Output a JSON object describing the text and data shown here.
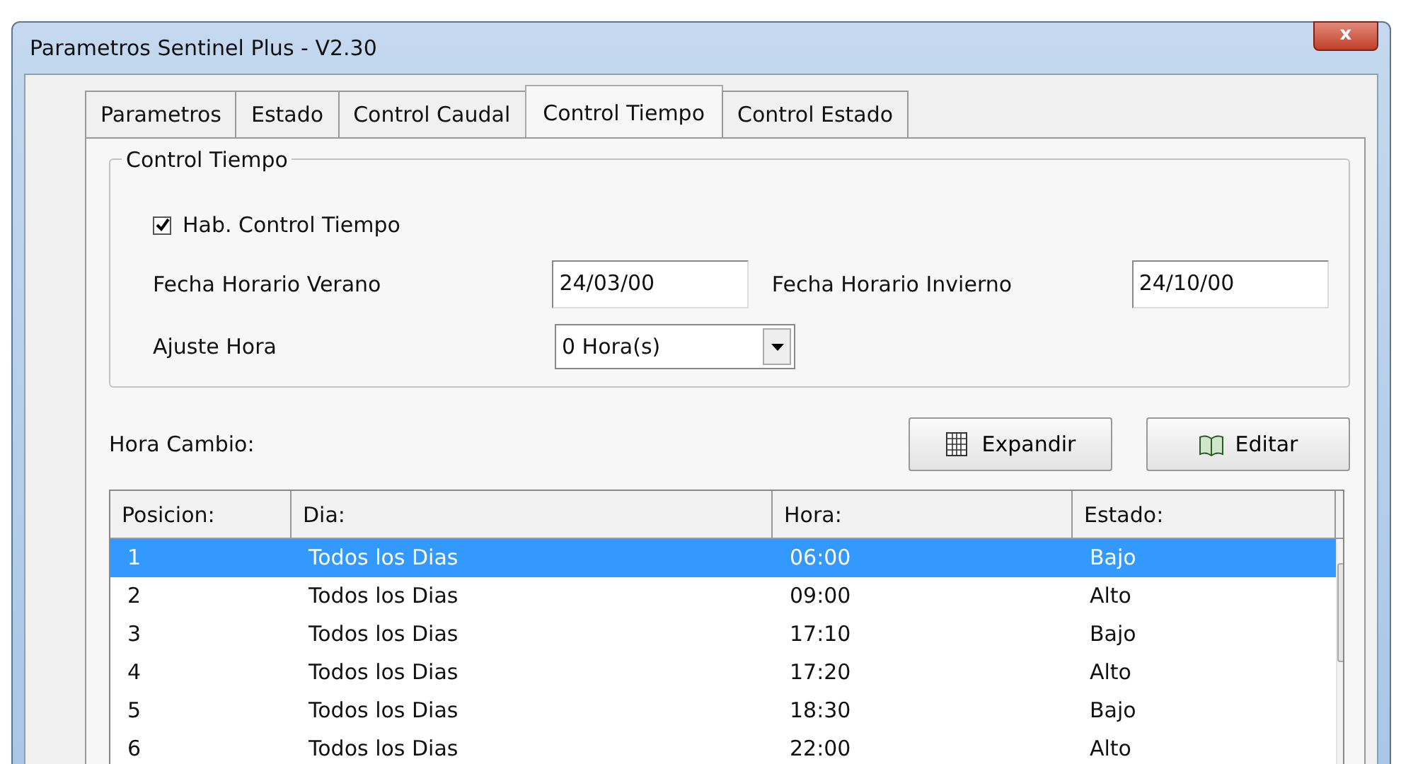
{
  "window": {
    "title": "Parametros Sentinel Plus - V2.30",
    "close": "x"
  },
  "tabs": [
    {
      "label": "Parametros",
      "selected": false
    },
    {
      "label": "Estado",
      "selected": false
    },
    {
      "label": "Control Caudal",
      "selected": false
    },
    {
      "label": "Control Tiempo",
      "selected": true
    },
    {
      "label": "Control Estado",
      "selected": false
    }
  ],
  "group": {
    "title": "Control Tiempo",
    "checkbox": {
      "label": "Hab. Control Tiempo",
      "checked": true
    },
    "summer_label": "Fecha Horario Verano",
    "summer_value": "24/03/00",
    "winter_label": "Fecha Horario Invierno",
    "winter_value": "24/10/00",
    "adjust_label": "Ajuste Hora",
    "adjust_value": "0 Hora(s)"
  },
  "hora_cambio_label": "Hora Cambio:",
  "buttons": [
    {
      "label": "Expandir",
      "kind": "grid"
    },
    {
      "label": "Editar",
      "kind": "book"
    }
  ],
  "table": {
    "columns": [
      "Posicion:",
      "Dia:",
      "Hora:",
      "Estado:"
    ],
    "rows": [
      {
        "cells": [
          "1",
          "Todos los Dias",
          "06:00",
          "Bajo"
        ],
        "selected": true
      },
      {
        "cells": [
          "2",
          "Todos los Dias",
          "09:00",
          "Alto"
        ],
        "selected": false
      },
      {
        "cells": [
          "3",
          "Todos los Dias",
          "17:10",
          "Bajo"
        ],
        "selected": false
      },
      {
        "cells": [
          "4",
          "Todos los Dias",
          "17:20",
          "Alto"
        ],
        "selected": false
      },
      {
        "cells": [
          "5",
          "Todos los Dias",
          "18:30",
          "Bajo"
        ],
        "selected": false
      },
      {
        "cells": [
          "6",
          "Todos los Dias",
          "22:00",
          "Alto"
        ],
        "selected": false
      }
    ]
  }
}
